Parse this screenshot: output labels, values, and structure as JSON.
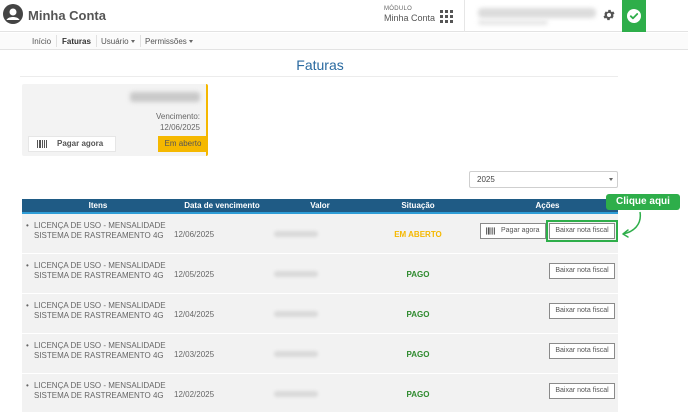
{
  "header": {
    "app_title": "Minha Conta",
    "module_label": "MÓDULO",
    "module_name": "Minha Conta",
    "status_color": "#2eae4a"
  },
  "nav": {
    "items": [
      {
        "label": "Início"
      },
      {
        "label": "Faturas"
      },
      {
        "label": "Usuário"
      },
      {
        "label": "Permissões"
      }
    ]
  },
  "page": {
    "title": "Faturas"
  },
  "summary": {
    "due_label": "Vencimento:",
    "due_date": "12/06/2025",
    "pay_label": "Pagar agora",
    "status_label": "Em aberto"
  },
  "filter": {
    "year": "2025"
  },
  "table": {
    "headers": [
      "Itens",
      "Data de vencimento",
      "Valor",
      "Situação",
      "Ações"
    ],
    "rows": [
      {
        "item_line1": "LICENÇA DE USO - MENSALIDADE",
        "item_line2": "SISTEMA DE RASTREAMENTO 4G",
        "date": "12/06/2025",
        "status": "EM ABERTO",
        "pay_label": "Pagar agora",
        "nf_label": "Baixar nota fiscal"
      },
      {
        "item_line1": "LICENÇA DE USO - MENSALIDADE",
        "item_line2": "SISTEMA DE RASTREAMENTO 4G",
        "date": "12/05/2025",
        "status": "PAGO",
        "nf_label": "Baixar nota fiscal"
      },
      {
        "item_line1": "LICENÇA DE USO - MENSALIDADE",
        "item_line2": "SISTEMA DE RASTREAMENTO 4G",
        "date": "12/04/2025",
        "status": "PAGO",
        "nf_label": "Baixar nota fiscal"
      },
      {
        "item_line1": "LICENÇA DE USO - MENSALIDADE",
        "item_line2": "SISTEMA DE RASTREAMENTO 4G",
        "date": "12/03/2025",
        "status": "PAGO",
        "nf_label": "Baixar nota fiscal"
      },
      {
        "item_line1": "LICENÇA DE USO - MENSALIDADE",
        "item_line2": "SISTEMA DE RASTREAMENTO 4G",
        "date": "12/02/2025",
        "status": "PAGO",
        "nf_label": "Baixar nota fiscal"
      }
    ]
  },
  "callout": {
    "label": "Clique aqui",
    "color": "#2eae4a"
  },
  "colors": {
    "accent_blue": "#1f5b85",
    "open_yellow": "#f5b800",
    "paid_green": "#2e8b2e"
  }
}
